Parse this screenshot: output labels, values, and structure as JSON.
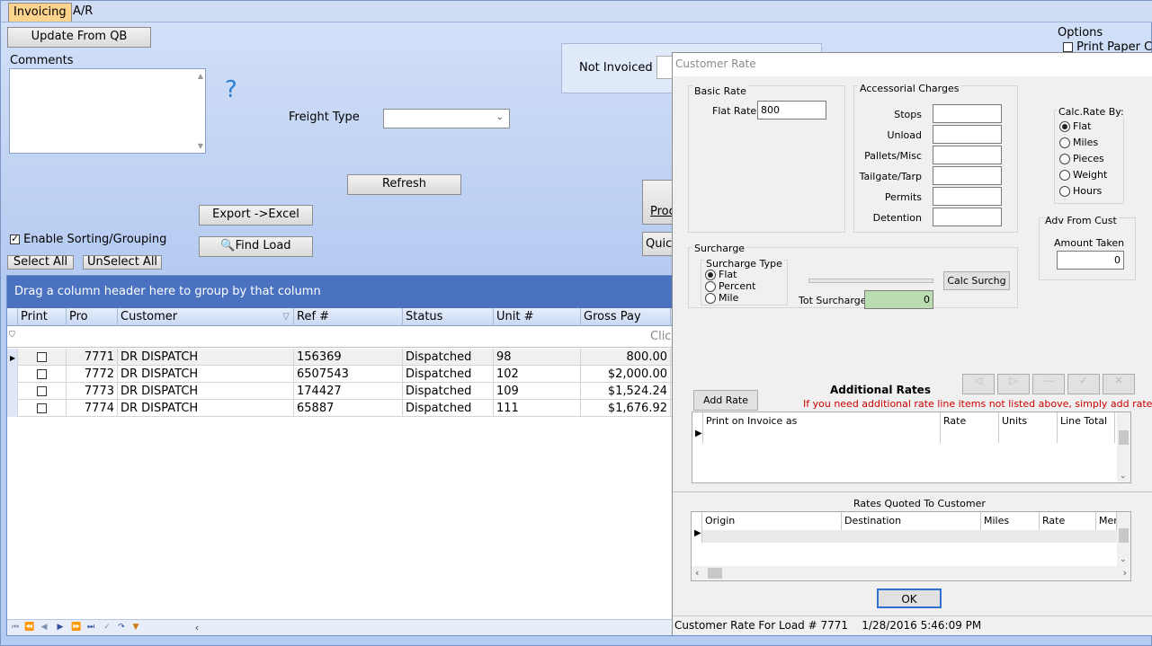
{
  "tabs": [
    "Invoicing",
    "A/R"
  ],
  "main": {
    "update_btn": "Update From QB",
    "comments_label": "Comments",
    "help_glyph": "?",
    "freight_type_label": "Freight Type",
    "refresh_btn": "Refresh",
    "export_btn": "Export ->Excel",
    "find_load_btn": "Find Load",
    "enable_sorting_label": "Enable Sorting/Grouping",
    "select_all_btn": "Select All",
    "unselect_all_btn": "UnSelect All",
    "not_invoiced_label": "Not Invoiced",
    "proc_btn_partial": "Proc",
    "quick_btn_partial": "Quick",
    "options_label": "Options",
    "print_paper_label": "Print Paper C"
  },
  "grid": {
    "group_hint": "Drag a column header here to group by that column",
    "filter_hint": "Click",
    "columns": [
      "Print",
      "Pro",
      "Customer",
      "Ref #",
      "Status",
      "Unit #",
      "Gross Pay"
    ],
    "rows": [
      {
        "pro": "7771",
        "customer": "DR DISPATCH",
        "ref": "156369",
        "status": "Dispatched",
        "unit": "98",
        "gross": "800.00"
      },
      {
        "pro": "7772",
        "customer": "DR DISPATCH",
        "ref": "6507543",
        "status": "Dispatched",
        "unit": "102",
        "gross": "$2,000.00"
      },
      {
        "pro": "7773",
        "customer": "DR DISPATCH",
        "ref": "174427",
        "status": "Dispatched",
        "unit": "109",
        "gross": "$1,524.24"
      },
      {
        "pro": "7774",
        "customer": "DR DISPATCH",
        "ref": "65887",
        "status": "Dispatched",
        "unit": "111",
        "gross": "$1,676.92"
      }
    ]
  },
  "dialog": {
    "title": "Customer Rate",
    "basic_rate_title": "Basic Rate",
    "flat_rate_label": "Flat Rate",
    "flat_rate_value": "800",
    "accessorial_title": "Accessorial Charges",
    "accessorial_items": [
      "Stops",
      "Unload",
      "Pallets/Misc",
      "Tailgate/Tarp",
      "Permits",
      "Detention"
    ],
    "calc_rate_title": "Calc.Rate By:",
    "calc_rate_options": [
      "Flat",
      "Miles",
      "Pieces",
      "Weight",
      "Hours"
    ],
    "calc_rate_selected": "Flat",
    "adv_title": "Adv From Cust",
    "amount_taken_label": "Amount Taken",
    "amount_taken_value": "0",
    "surcharge_title": "Surcharge",
    "surcharge_type_title": "Surcharge Type",
    "surcharge_options": [
      "Flat",
      "Percent",
      "Mile"
    ],
    "surcharge_selected": "Flat",
    "calc_surchg_btn": "Calc Surchg",
    "tot_surcharge_label": "Tot Surcharge",
    "tot_surcharge_value": "0",
    "add_rate_btn": "Add Rate",
    "additional_rates_title": "Additional Rates",
    "additional_rates_hint": "If you need additional rate line items not listed above, simply add rates below",
    "add_grid_columns": [
      "Print on Invoice as",
      "Rate",
      "Units",
      "Line Total"
    ],
    "rates_quoted_title": "Rates Quoted To Customer",
    "quoted_columns": [
      "Origin",
      "Destination",
      "Miles",
      "Rate",
      "Men"
    ],
    "ok_btn": "OK",
    "status_text": "Customer Rate For Load # 7771    1/28/2016 5:46:09 PM"
  },
  "colors": {
    "accent": "#4a72c0",
    "tab_active": "#fbd38c",
    "hint_red": "#cc0000",
    "surcharge_field": "#b9dcb0"
  }
}
